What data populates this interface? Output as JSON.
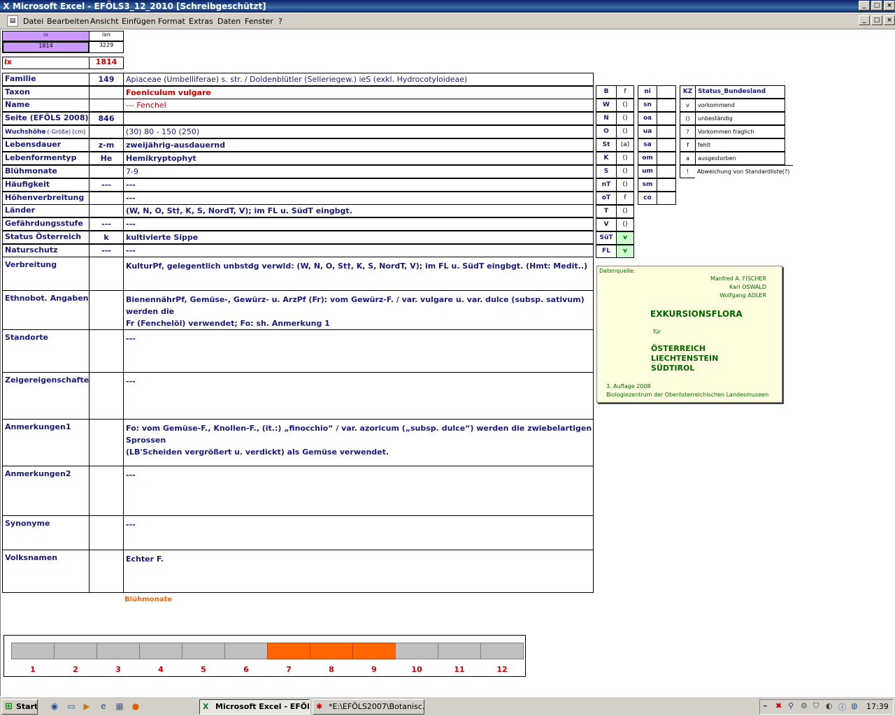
{
  "window": {
    "title": "Microsoft Excel - EFÖLS3_12_2010  [Schreibgeschützt]",
    "min": "_",
    "max": "□",
    "close": "×"
  },
  "menu": {
    "items": [
      "Datei",
      "Bearbeiten",
      "Ansicht",
      "Einfügen",
      "Format",
      "Extras",
      "Daten",
      "Fenster",
      "?"
    ]
  },
  "top": {
    "ix_label": "ix",
    "ixn_label": "ixn",
    "ix_value": "1814",
    "ixn_value": "3229",
    "ix2_label": "ix",
    "ix2_value": "1814"
  },
  "rows": [
    {
      "label": "Familie",
      "code": "149",
      "value": "Apiaceae (Umbelliferae) s. str.  /  Doldenblütler (Selleriegew.) ieS (exkl. Hydrocotyloideae)"
    },
    {
      "label": "Taxon",
      "code": "",
      "value": "Foeniculum vulgare"
    },
    {
      "label": "Name",
      "code": "",
      "value": "--- Fenchel"
    },
    {
      "label": "Seite (EFÖLS 2008)",
      "code": "846",
      "value": ""
    },
    {
      "label": "Wuchshöhe",
      "label_suffix": "(-Größe) [cm]",
      "code": "",
      "value": "(30) 80 - 150 (250)"
    },
    {
      "label": "Lebensdauer",
      "code": "z-m",
      "value": "zweijährig-ausdauernd"
    },
    {
      "label": "Lebenformentyp",
      "code": "He",
      "value": "Hemikryptophyt"
    },
    {
      "label": "Blühmonate",
      "code": "",
      "value": "7-9"
    },
    {
      "label": "Häufigkeit",
      "code": "---",
      "value": "---"
    },
    {
      "label": "Höhenverbreitung",
      "code": "",
      "value": "---"
    },
    {
      "label": "Länder",
      "code": "",
      "value": "(W, N, O, St†, K, S, NordT, V); im FL u. SüdT eingbgt."
    },
    {
      "label": "Gefährdungsstufe",
      "code": "---",
      "value": "---"
    },
    {
      "label": "Status Österreich",
      "code": "k",
      "value": "kultivierte Sippe"
    },
    {
      "label": "Naturschutz",
      "code": "---",
      "value": "---"
    }
  ],
  "big_rows": [
    {
      "label": "Verbreitung",
      "value": "KulturPf, gelegentlich unbstdg verwld: (W, N, O, St†, K, S, NordT, V); im FL u. SüdT eingbgt. (Hmt: Medit..)",
      "value2": ""
    },
    {
      "label": "Ethnobot. Angaben",
      "value": "BienennährPf, Gemüse-, Gewürz- u. ArzPf (Fr): vom  Gewürz-F. / var. vulgare u. var. dulce (subsp. sativum) werden die",
      "value2": "Fr (Fenchelöl) verwendet; Fo: sh. Anmerkung 1"
    },
    {
      "label": "Standorte",
      "value": "---",
      "value2": ""
    },
    {
      "label": "Zeigereigenschaften",
      "value": "---",
      "value2": ""
    },
    {
      "label": "Anmerkungen1",
      "value": "Fo:  vom Gemüse-F., Knollen-F., (it.:) „finocchio“ / var. azoricum („subsp. dulce“) werden die zwiebelartigen Sprossen",
      "value2": "(LB'Scheiden vergrößert u. verdickt) als Gemüse verwendet."
    },
    {
      "label": "Anmerkungen2",
      "value": "---",
      "value2": ""
    },
    {
      "label": "Synonyme",
      "value": "---",
      "value2": ""
    },
    {
      "label": "Volksnamen",
      "value": "Echter F.",
      "value2": ""
    }
  ],
  "states": [
    {
      "k": "B",
      "v": "f"
    },
    {
      "k": "W",
      "v": "()"
    },
    {
      "k": "N",
      "v": "()"
    },
    {
      "k": "O",
      "v": "()"
    },
    {
      "k": "St",
      "v": "(a)"
    },
    {
      "k": "K",
      "v": "()"
    },
    {
      "k": "S",
      "v": "()"
    },
    {
      "k": "nT",
      "v": "()"
    },
    {
      "k": "oT",
      "v": "f"
    },
    {
      "k": "T",
      "v": "()"
    },
    {
      "k": "V",
      "v": "()"
    },
    {
      "k": "SüT",
      "v": "v"
    },
    {
      "k": "FL",
      "v": "v"
    }
  ],
  "alt": [
    {
      "k": "ni"
    },
    {
      "k": "sn"
    },
    {
      "k": "oa"
    },
    {
      "k": "ua"
    },
    {
      "k": "sa"
    },
    {
      "k": "om"
    },
    {
      "k": "um"
    },
    {
      "k": "sm"
    },
    {
      "k": "co"
    }
  ],
  "legend": {
    "kz": "KZ",
    "title": "Status_Bundesland",
    "items": [
      {
        "k": "v",
        "v": "vorkommend"
      },
      {
        "k": "()",
        "v": "unbeständig"
      },
      {
        "k": "?",
        "v": "Vorkommen fraglich"
      },
      {
        "k": "f",
        "v": "fehlt"
      },
      {
        "k": "a",
        "v": "ausgestorben"
      },
      {
        "k": "!",
        "v": "Abweichung von Standardliste(?)"
      }
    ]
  },
  "source": {
    "label": "Datenquelle:",
    "authors": [
      "Manfred A. FISCHER",
      "Karl OSWALD",
      "Wolfgang ADLER"
    ],
    "title": "EXKURSIONSFLORA",
    "fuer": "für",
    "countries": [
      "ÖSTERREICH",
      "LIECHTENSTEIN",
      "SÜDTIROL"
    ],
    "edition": "3. Auflage 2008",
    "publisher": "Biologiezentrum der Oberösterreichischen Landesmuseen"
  },
  "months": {
    "title": "Blühmonate",
    "labels": [
      "1",
      "2",
      "3",
      "4",
      "5",
      "6",
      "7",
      "8",
      "9",
      "10",
      "11",
      "12"
    ],
    "active": [
      7,
      8,
      9
    ],
    "colors": {
      "on": "#ff6600",
      "off": "#c0c0c0"
    }
  },
  "taskbar": {
    "start": "Start",
    "tasks": [
      "Microsoft Excel - EFÖL...",
      "*E:\\EFÖLS2007\\Botanisc..."
    ],
    "clock": "17:39"
  }
}
